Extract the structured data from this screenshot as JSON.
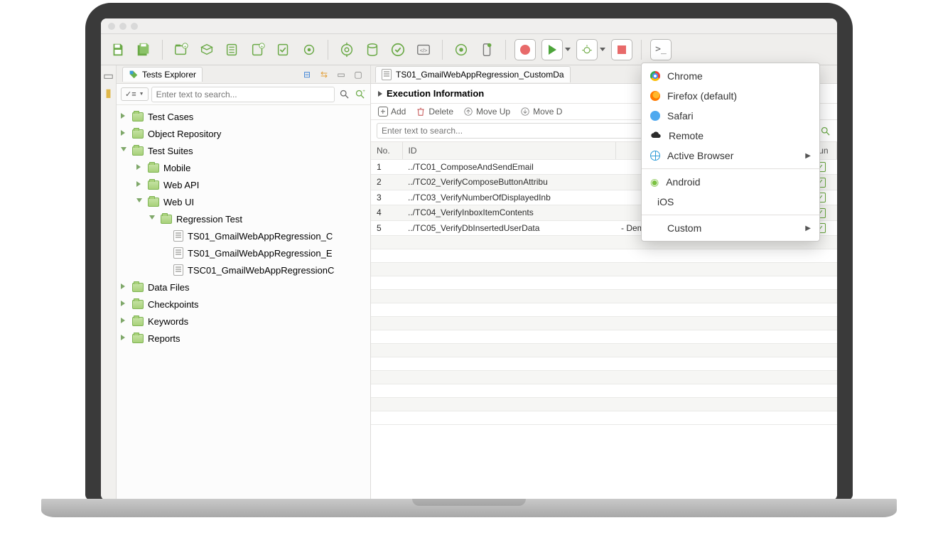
{
  "explorer": {
    "title": "Tests Explorer",
    "search_placeholder": "Enter text to search...",
    "tree": {
      "test_cases": "Test Cases",
      "object_repo": "Object Repository",
      "test_suites": "Test Suites",
      "mobile": "Mobile",
      "web_api": "Web API",
      "web_ui": "Web UI",
      "regression_test": "Regression Test",
      "ts01c": "TS01_GmailWebAppRegression_C",
      "ts01e": "TS01_GmailWebAppRegression_E",
      "tsc01": "TSC01_GmailWebAppRegressionC",
      "data_files": "Data Files",
      "checkpoints": "Checkpoints",
      "keywords": "Keywords",
      "reports": "Reports"
    }
  },
  "editor": {
    "tab_label": "TS01_GmailWebAppRegression_CustomDa",
    "section_title": "Execution Information",
    "actions": {
      "add": "Add",
      "delete": "Delete",
      "move_up": "Move Up",
      "move_down": "Move D"
    },
    "search_placeholder": "Enter text to search...",
    "columns": {
      "no": "No.",
      "id": "ID",
      "run": "Run"
    },
    "rows": [
      {
        "no": "1",
        "id": "../TC01_ComposeAndSendEmail",
        "desc": ""
      },
      {
        "no": "2",
        "id": "../TC02_VerifyComposeButtonAttribu",
        "desc": ""
      },
      {
        "no": "3",
        "id": "../TC03_VerifyNumberOfDisplayedInb",
        "desc": ""
      },
      {
        "no": "4",
        "id": "../TC04_VerifyInboxItemContents",
        "desc": ""
      },
      {
        "no": "5",
        "id": "../TC05_VerifyDbInsertedUserData",
        "desc": "- Demonstrate how to acc"
      }
    ]
  },
  "run_menu": {
    "chrome": "Chrome",
    "firefox": "Firefox (default)",
    "safari": "Safari",
    "remote": "Remote",
    "active_browser": "Active Browser",
    "android": "Android",
    "ios": "iOS",
    "custom": "Custom"
  }
}
